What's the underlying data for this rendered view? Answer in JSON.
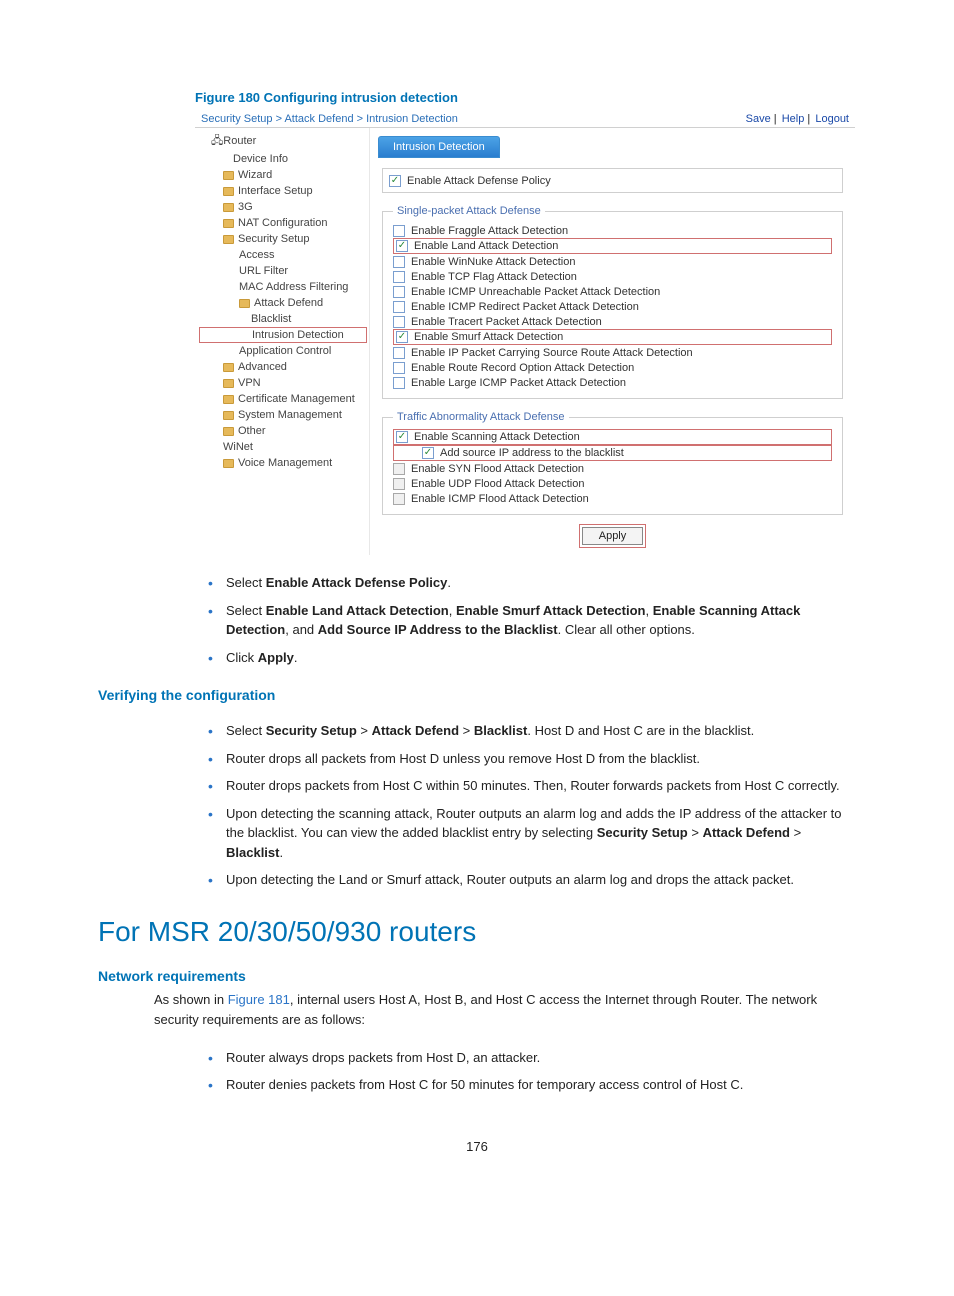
{
  "figure_title": "Figure 180 Configuring intrusion detection",
  "breadcrumb": "Security Setup > Attack Defend > Intrusion Detection",
  "top_links": {
    "save": "Save",
    "help": "Help",
    "logout": "Logout"
  },
  "root_label": "Router",
  "nav": {
    "device_info": "Device Info",
    "wizard": "Wizard",
    "interface_setup": "Interface Setup",
    "g3": "3G",
    "nat": "NAT Configuration",
    "security": "Security Setup",
    "access": "Access",
    "url_filter": "URL Filter",
    "mac_filter": "MAC Address Filtering",
    "attack_defend": "Attack Defend",
    "blacklist": "Blacklist",
    "intrusion": "Intrusion Detection",
    "app_control": "Application Control",
    "advanced": "Advanced",
    "vpn": "VPN",
    "cert": "Certificate Management",
    "sys_mgmt": "System Management",
    "other": "Other",
    "winet": "WiNet",
    "voice": "Voice Management"
  },
  "tab_label": "Intrusion Detection",
  "enable_policy": "Enable Attack Defense Policy",
  "group1_legend": "Single-packet Attack Defense",
  "group1": {
    "fraggle": "Enable Fraggle Attack Detection",
    "land": "Enable Land Attack Detection",
    "winnuke": "Enable WinNuke Attack Detection",
    "tcpflag": "Enable TCP Flag Attack Detection",
    "icmp_unreach": "Enable ICMP Unreachable Packet Attack Detection",
    "icmp_redirect": "Enable ICMP Redirect Packet Attack Detection",
    "tracert": "Enable Tracert Packet Attack Detection",
    "smurf": "Enable Smurf Attack Detection",
    "src_route": "Enable IP Packet Carrying Source Route Attack Detection",
    "route_record": "Enable Route Record Option Attack Detection",
    "large_icmp": "Enable Large ICMP Packet Attack Detection"
  },
  "group2_legend": "Traffic Abnormality Attack Defense",
  "group2": {
    "scanning": "Enable Scanning Attack Detection",
    "add_blacklist": "Add source IP address to the blacklist",
    "syn_flood": "Enable SYN Flood Attack Detection",
    "udp_flood": "Enable UDP Flood Attack Detection",
    "icmp_flood": "Enable ICMP Flood Attack Detection"
  },
  "apply_label": "Apply",
  "doc": {
    "b1_pre": "Select ",
    "b1_bold": "Enable Attack Defense Policy",
    "b1_post": ".",
    "b2_pre": "Select ",
    "b2_a": "Enable Land Attack Detection",
    "b2_sep1": ", ",
    "b2_b": "Enable Smurf Attack Detection",
    "b2_sep2": ", ",
    "b2_c": "Enable Scanning Attack Detection",
    "b2_sep3": ", and ",
    "b2_d": "Add Source IP Address to the Blacklist",
    "b2_post": ". Clear all other options.",
    "b3_pre": "Click ",
    "b3_bold": "Apply",
    "b3_post": ".",
    "verify_h": "Verifying the configuration",
    "v1_pre": "Select ",
    "v1_a": "Security Setup",
    "v1_s1": " > ",
    "v1_b": "Attack Defend",
    "v1_s2": " > ",
    "v1_c": "Blacklist",
    "v1_post": ". Host D and Host C are in the blacklist.",
    "v2": "Router drops all packets from Host D unless you remove Host D from the blacklist.",
    "v3": "Router drops packets from Host C within 50 minutes. Then, Router forwards packets from Host C correctly.",
    "v4_pre": "Upon detecting the scanning attack, Router outputs an alarm log and adds the IP address of the attacker to the blacklist. You can view the added blacklist entry by selecting ",
    "v4_a": "Security Setup",
    "v4_s1": " > ",
    "v4_b": "Attack Defend",
    "v4_s2": " > ",
    "v4_c": "Blacklist",
    "v4_post": ".",
    "v5": "Upon detecting the Land or Smurf attack, Router outputs an alarm log and drops the attack packet.",
    "h2": "For MSR 20/30/50/930 routers",
    "net_req_h": "Network requirements",
    "nr_para_pre": "As shown in ",
    "nr_ref": "Figure 181",
    "nr_para_post": ", internal users Host A, Host B, and Host C access the Internet through Router. The network security requirements are as follows:",
    "nr1": "Router always drops packets from Host D, an attacker.",
    "nr2": "Router denies packets from Host C for 50 minutes for temporary access control of Host C.",
    "page_num": "176"
  }
}
